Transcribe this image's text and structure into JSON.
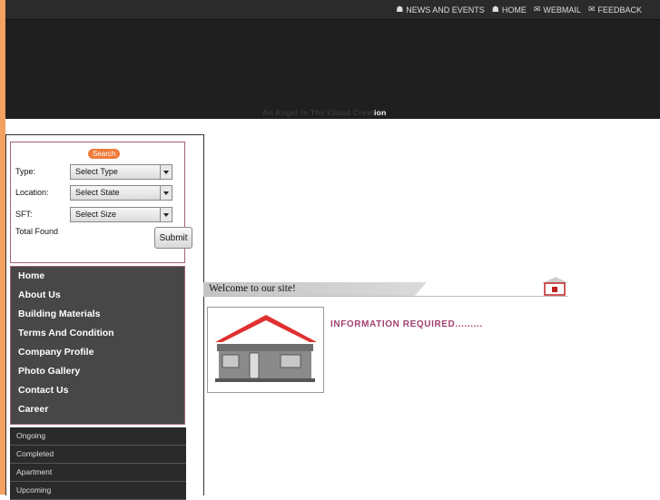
{
  "topnav": [
    {
      "icon": "home-icon",
      "label": "NEWS AND EVENTS"
    },
    {
      "icon": "home-icon",
      "label": "HOME"
    },
    {
      "icon": "mail-icon",
      "label": "WEBMAIL"
    },
    {
      "icon": "mail-icon",
      "label": "FEEDBACK"
    }
  ],
  "tagline": {
    "dim": "An Angel In The Cloud Creat",
    "lit": "ion"
  },
  "search": {
    "badge": "Search",
    "fields": [
      {
        "label": "Type:",
        "value": "Select Type"
      },
      {
        "label": "Location:",
        "value": "Select State"
      },
      {
        "label": "SFT:",
        "value": "Select Size"
      }
    ],
    "total_label": "Total Found",
    "submit_label": "Submit"
  },
  "menu": [
    "Home",
    "About Us",
    "Building Materials",
    "Terms And Condition",
    "Company Profile",
    "Photo Gallery",
    "Contact Us",
    "Career"
  ],
  "submenu": [
    "Ongoing",
    "Completed",
    "Apartment",
    "Upcoming"
  ],
  "welcome": "Welcome to our site!",
  "info": "INFORMATION REQUIRED.........",
  "colors": {
    "accent": "#f07a3a",
    "brand": "#a04070",
    "header": "#1f1f1f",
    "menu": "#474747"
  }
}
